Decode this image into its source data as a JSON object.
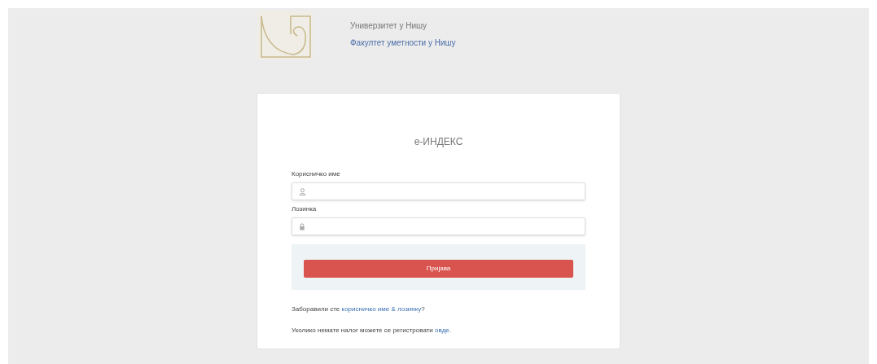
{
  "header": {
    "university": "Универзитет у Нишу",
    "faculty": "Факултет уметности у Нишу"
  },
  "login": {
    "title": "е-ИНДЕКС",
    "fields": [
      {
        "label": "Корисничко име",
        "kind": "user"
      },
      {
        "label": "Лозинка",
        "kind": "password"
      }
    ],
    "submit": "Пријава",
    "forgot": {
      "before": "Заборавили сте ",
      "link": "корисничко име & лозинку",
      "after": "?"
    },
    "register": {
      "before": "Уколико немате налог можете се регистровати ",
      "link": "овде",
      "after": "."
    }
  }
}
